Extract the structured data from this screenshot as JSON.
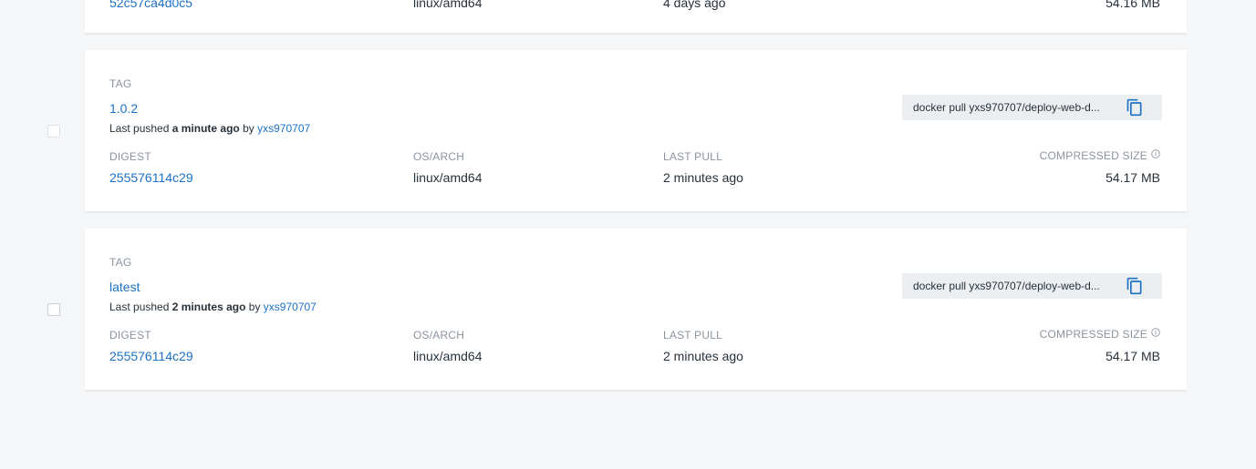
{
  "labels": {
    "tag": "TAG",
    "digest": "DIGEST",
    "os_arch": "OS/ARCH",
    "last_pull": "LAST PULL",
    "compressed_size": "COMPRESSED SIZE",
    "last_pushed_prefix": "Last pushed",
    "by": "by"
  },
  "partial_row": {
    "digest": "52c57ca4d0c5",
    "os_arch": "linux/amd64",
    "last_pull": "4 days ago",
    "compressed_size": "54.16 MB"
  },
  "tags": [
    {
      "name": "1.0.2",
      "pushed_when": "a minute ago",
      "pushed_by": "yxs970707",
      "pull_command": "docker pull yxs970707/deploy-web-d...",
      "digest": "255576114c29",
      "os_arch": "linux/amd64",
      "last_pull": "2 minutes ago",
      "compressed_size": "54.17 MB"
    },
    {
      "name": "latest",
      "pushed_when": "2 minutes ago",
      "pushed_by": "yxs970707",
      "pull_command": "docker pull yxs970707/deploy-web-d...",
      "digest": "255576114c29",
      "os_arch": "linux/amd64",
      "last_pull": "2 minutes ago",
      "compressed_size": "54.17 MB"
    }
  ],
  "icons": {
    "copy": "copy-icon",
    "info": "info-icon"
  },
  "colors": {
    "link": "#1c71c5",
    "background": "#f5f6f8",
    "pull_box": "#eceff2"
  }
}
